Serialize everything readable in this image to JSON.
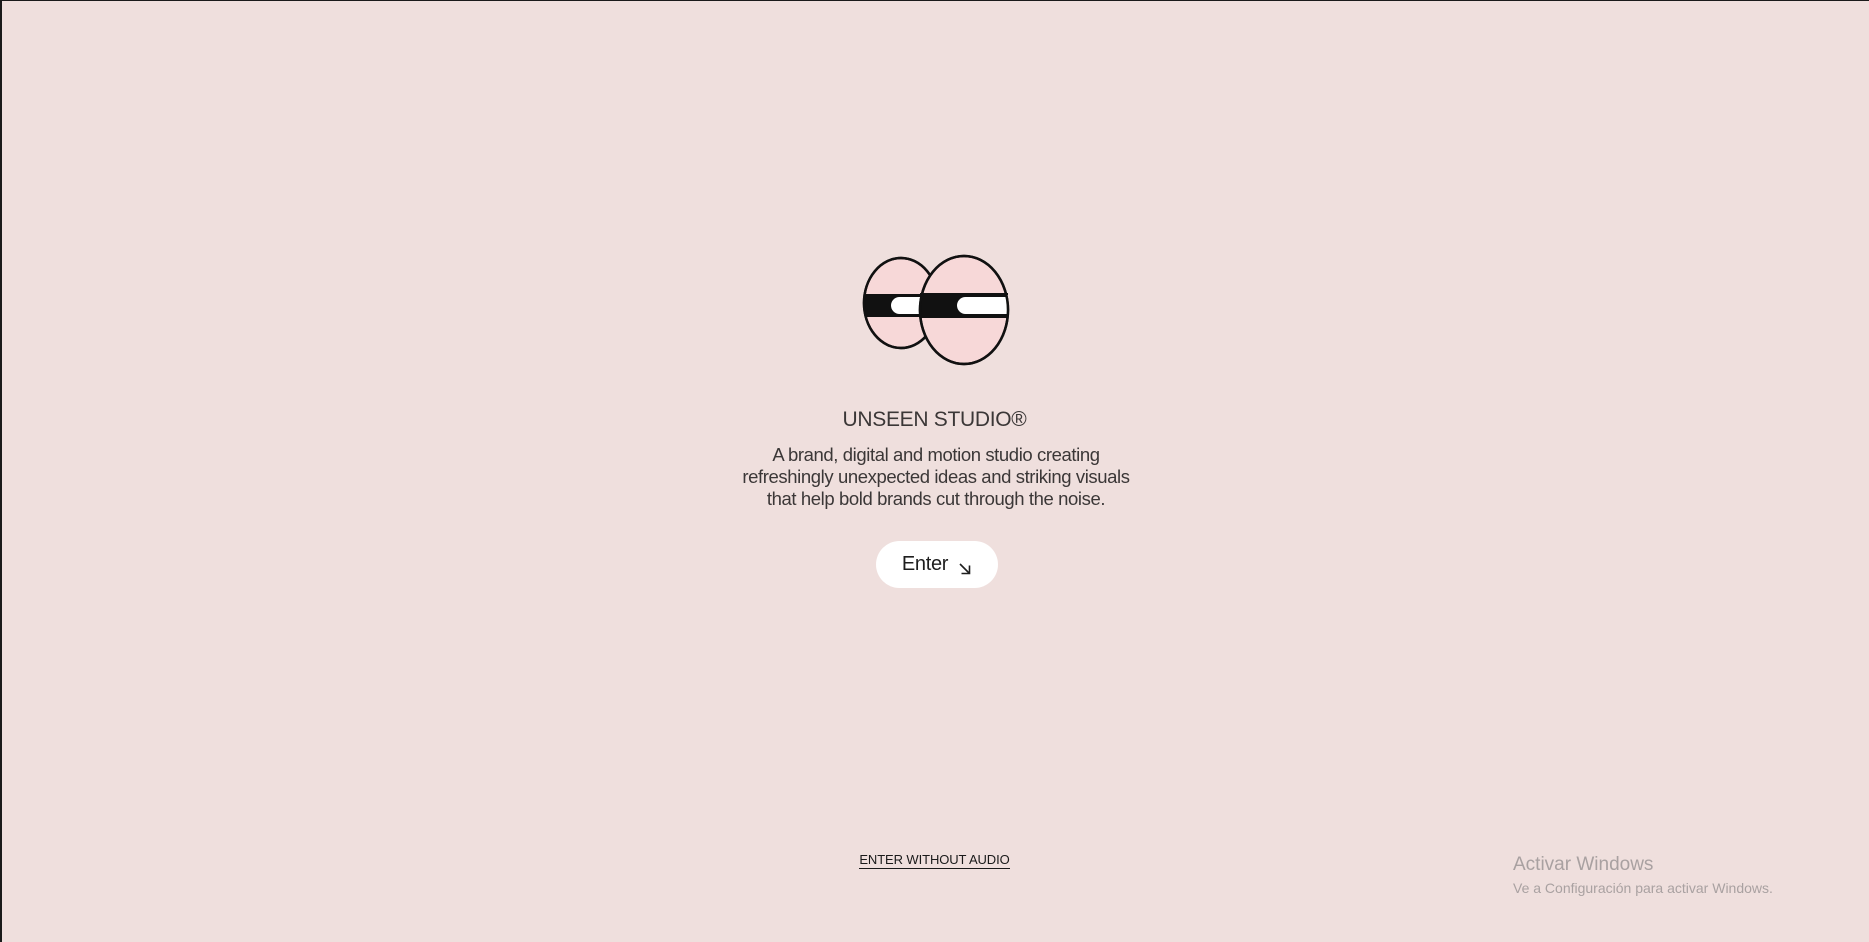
{
  "studio": {
    "name": "UNSEEN STUDIO®",
    "description_lines": [
      "A brand, digital and motion studio creating",
      "refreshingly unexpected ideas and striking visuals",
      "that help bold brands cut through the noise."
    ]
  },
  "actions": {
    "enter_label": "Enter",
    "enter_icon": "arrow-down-right-icon",
    "no_audio_label": "ENTER WITHOUT AUDIO"
  },
  "watermark": {
    "title": "Activar Windows",
    "subtitle": "Ve a Configuración para activar Windows."
  },
  "colors": {
    "background": "#efdfdd",
    "eye_fill": "#f7d8d8",
    "button_bg": "#ffffff",
    "text": "#3b3737"
  }
}
